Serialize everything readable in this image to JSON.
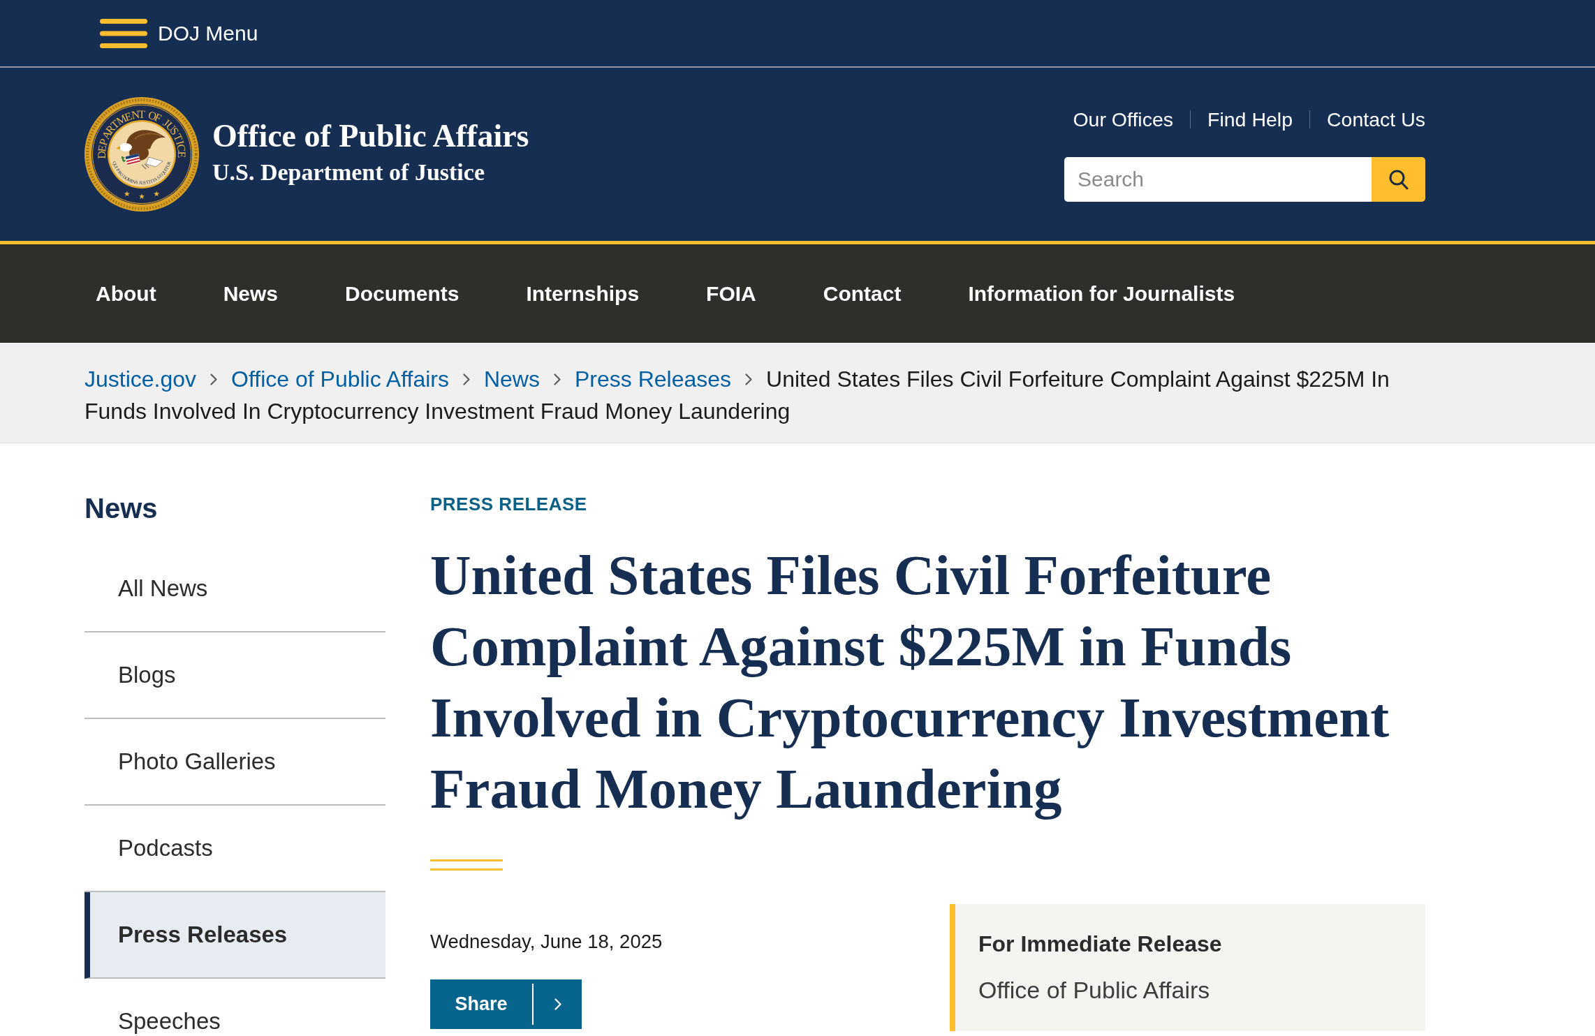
{
  "top_bar": {
    "menu_label": "DOJ Menu"
  },
  "header": {
    "seal": {
      "ring_text": "DEPARTMENT OF JUSTICE",
      "motto": "QUI PRO DOMINA JUSTITIA SEQUITUR"
    },
    "title": "Office of Public Affairs",
    "subtitle": "U.S. Department of Justice",
    "utility_links": [
      "Our Offices",
      "Find Help",
      "Contact Us"
    ],
    "search": {
      "placeholder": "Search"
    }
  },
  "main_nav": [
    "About",
    "News",
    "Documents",
    "Internships",
    "FOIA",
    "Contact",
    "Information for Journalists"
  ],
  "breadcrumb": {
    "links": [
      "Justice.gov",
      "Office of Public Affairs",
      "News",
      "Press Releases"
    ],
    "current_lines": [
      "United States Files Civil Forfeiture Complaint Against $225M In",
      "Funds Involved In Cryptocurrency Investment Fraud Money Laundering"
    ]
  },
  "sidebar": {
    "heading": "News",
    "items": [
      {
        "label": "All News",
        "selected": false
      },
      {
        "label": "Blogs",
        "selected": false
      },
      {
        "label": "Photo Galleries",
        "selected": false
      },
      {
        "label": "Podcasts",
        "selected": false
      },
      {
        "label": "Press Releases",
        "selected": true
      },
      {
        "label": "Speeches",
        "selected": false
      }
    ]
  },
  "article": {
    "eyebrow": "PRESS RELEASE",
    "title": "United States Files Civil Forfeiture Complaint Against $225M in Funds Involved in Cryptocurrency Investment Fraud Money Laundering",
    "date": "Wednesday, June 18, 2025",
    "share_label": "Share",
    "release_box": {
      "heading": "For Immediate Release",
      "source": "Office of Public Affairs"
    }
  }
}
